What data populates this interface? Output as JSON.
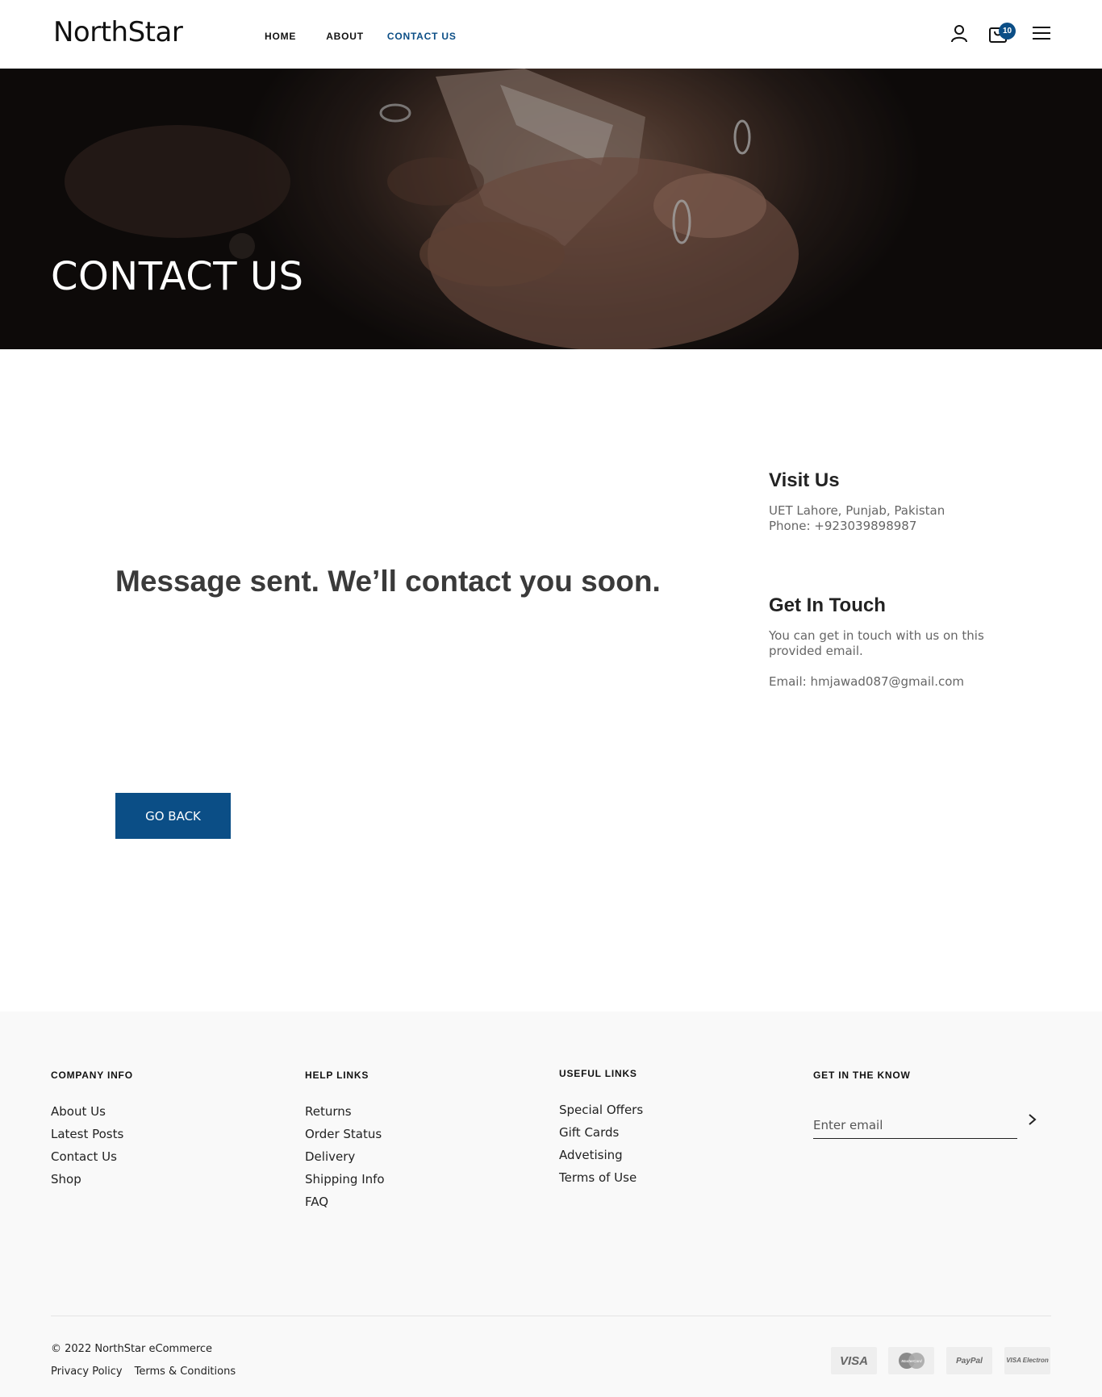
{
  "header": {
    "logo": "NorthStar",
    "nav": [
      {
        "label": "HOME"
      },
      {
        "label": "ABOUT"
      },
      {
        "label": "CONTACT US"
      }
    ],
    "cart_count": "10",
    "accent_color": "#0b4e86"
  },
  "hero": {
    "title": "CONTACT US"
  },
  "main": {
    "message": "Message sent. We’ll contact you soon.",
    "go_back_label": "GO BACK"
  },
  "info": {
    "visit_title": "Visit Us",
    "visit_address": "UET Lahore, Punjab, Pakistan",
    "visit_phone": "Phone: +923039898987",
    "touch_title": "Get In Touch",
    "touch_desc": "You can get in touch with us on this provided email.",
    "touch_email": "Email: hmjawad087@gmail.com"
  },
  "footer": {
    "columns": [
      {
        "title": "COMPANY INFO",
        "links": [
          "About Us",
          "Latest Posts",
          "Contact Us",
          "Shop"
        ]
      },
      {
        "title": "HELP LINKS",
        "links": [
          "Returns",
          "Order Status",
          "Delivery",
          "Shipping Info",
          "FAQ"
        ]
      },
      {
        "title": "USEFUL LINKS",
        "links": [
          "Special Offers",
          "Gift Cards",
          "Advetising",
          "Terms of Use"
        ]
      },
      {
        "title": "GET IN THE KNOW"
      }
    ],
    "email_placeholder": "Enter email",
    "copyright": "© 2022 NorthStar eCommerce",
    "legal": [
      "Privacy Policy",
      "Terms & Conditions"
    ],
    "payments": [
      "VISA",
      "MasterCard",
      "PayPal",
      "VISA Electron"
    ]
  }
}
